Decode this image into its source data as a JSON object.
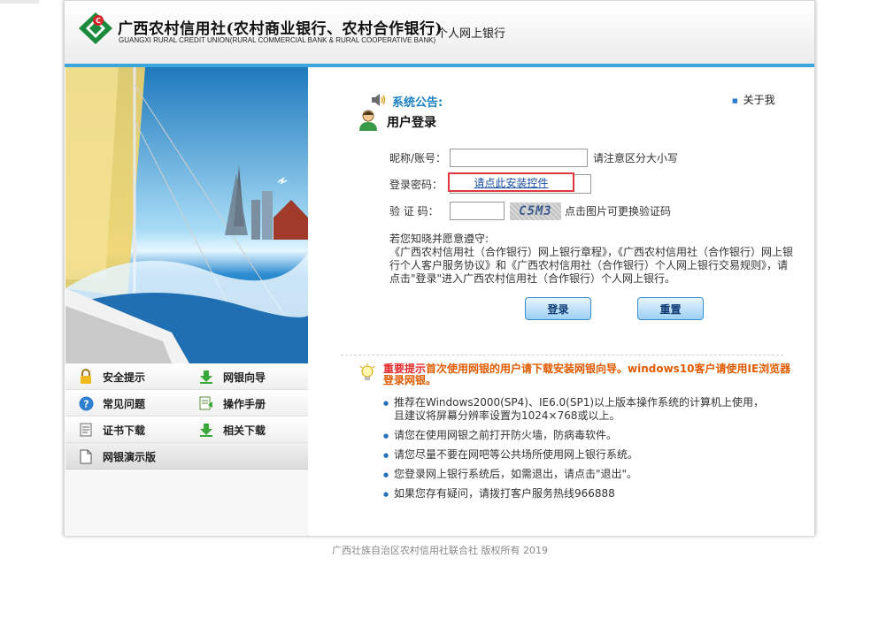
{
  "header": {
    "brand_cn": "广西农村信用社(农村商业银行、农村合作银行)",
    "brand_en": "GUANGXI RURAL CREDIT UNION(RURAL COMMERCIAL BANK & RURAL COOPERATIVE BANK)",
    "subtitle": "个人网上银行"
  },
  "menu": {
    "security": "安全提示",
    "guide": "网银向导",
    "faq": "常见问题",
    "manual": "操作手册",
    "cert": "证书下载",
    "downloads": "相关下载",
    "demo": "网银演示版"
  },
  "login": {
    "notice_label": "系统公告:",
    "about_label": "关于我",
    "title": "用户登录",
    "account_label": "昵称/账号：",
    "account_hint": "请注意区分大小写",
    "password_label": "登录密码：",
    "install_link": "请点此安装控件",
    "captcha_label": "验 证 码：",
    "captcha_text": "C5M3",
    "captcha_hint": "点击图片可更换验证码",
    "terms": "若您知晓并愿意遵守:\n《广西农村信用社（合作银行）网上银行章程》，《广西农村信用社（合作银行）网上银行个人客户服务协议》和《广西农村信用社（合作银行）个人网上银行交易规则》，请点击\"登录\"进入广西农村信用社（合作银行）个人网上银行。",
    "login_button": "登录",
    "reset_button": "重置"
  },
  "tips": {
    "heading_red": "重要提示",
    "heading_orange": "首次使用网银的用户请下载安装网银向导。windows10客户请使用IE浏览器登录网银。",
    "items": [
      "推荐在Windows2000(SP4)、IE6.0(SP1)以上版本操作系统的计算机上使用，且建议将屏幕分辨率设置为1024×768或以上。",
      "请您在使用网银之前打开防火墙，防病毒软件。",
      "请您尽量不要在网吧等公共场所使用网上银行系统。",
      "您登录网上银行系统后，如需退出，请点击\"退出\"。",
      "如果您存有疑问，请拨打客户服务热线966888"
    ]
  },
  "footer": "广西壮族自治区农村信用社联合社 版权所有 2019",
  "colors": {
    "accent_blue": "#3aa6dc",
    "link_blue": "#1b7fc4",
    "warning_orange": "#e05a00",
    "highlight_red": "#e0383e",
    "logo_green": "#1c8a3c"
  }
}
